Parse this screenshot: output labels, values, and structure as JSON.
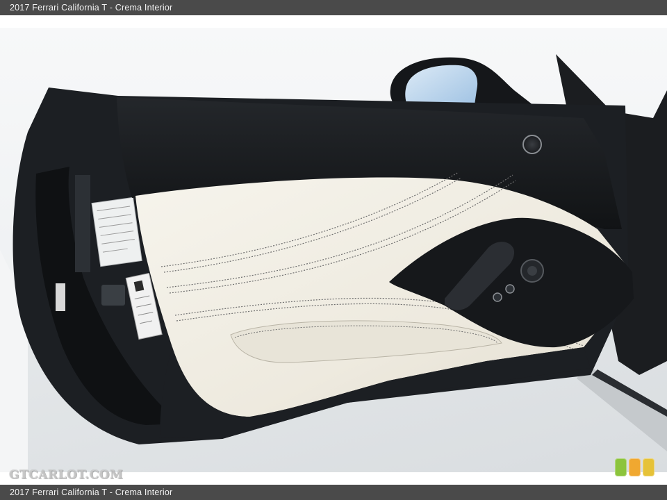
{
  "caption": {
    "top_title": "2017 Ferrari California T - Crema Interior",
    "bottom_title": "2017 Ferrari California T - Crema Interior"
  },
  "photo": {
    "subject": "open-door-interior-panel",
    "colors": {
      "frame_dark": "#1c1f23",
      "upper_panel_black": "#15171a",
      "leather_crema": "#f1eee4",
      "stitching": "#6e6e6e",
      "floor": "#e3e6e8",
      "sky_wall": "#f3f4f5",
      "mirror_glass": "#bcd6ee"
    }
  },
  "watermark": {
    "text": "GTCARLOT.COM"
  },
  "tiles": [
    {
      "name": "green-tile",
      "color": "#8cc43c"
    },
    {
      "name": "orange-tile",
      "color": "#f0a830"
    },
    {
      "name": "yellow-tile",
      "color": "#e6c238"
    }
  ]
}
